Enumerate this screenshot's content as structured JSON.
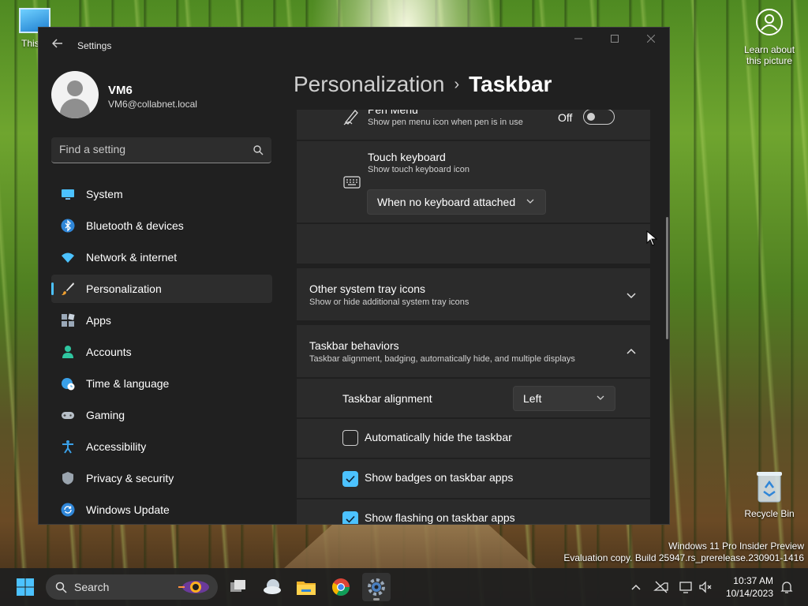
{
  "desktop": {
    "this_pc_label": "This P",
    "learn_label": "Learn about this picture",
    "recycle_label": "Recycle Bin",
    "watermark_line1": "Windows 11 Pro Insider Preview",
    "watermark_line2": "Evaluation copy. Build 25947.rs_prerelease.230901-1416"
  },
  "window": {
    "app_title": "Settings",
    "back_icon": "arrow-left-icon"
  },
  "profile": {
    "name": "VM6",
    "email": "VM6@collabnet.local"
  },
  "search": {
    "placeholder": "Find a setting"
  },
  "nav": {
    "items": [
      {
        "label": "System",
        "icon": "monitor-icon"
      },
      {
        "label": "Bluetooth & devices",
        "icon": "bluetooth-icon"
      },
      {
        "label": "Network & internet",
        "icon": "wifi-icon"
      },
      {
        "label": "Personalization",
        "icon": "brush-icon",
        "active": true
      },
      {
        "label": "Apps",
        "icon": "apps-icon"
      },
      {
        "label": "Accounts",
        "icon": "person-icon"
      },
      {
        "label": "Time & language",
        "icon": "globe-clock-icon"
      },
      {
        "label": "Gaming",
        "icon": "gamepad-icon"
      },
      {
        "label": "Accessibility",
        "icon": "accessibility-icon"
      },
      {
        "label": "Privacy & security",
        "icon": "shield-icon"
      },
      {
        "label": "Windows Update",
        "icon": "update-icon"
      }
    ]
  },
  "breadcrumb": {
    "parent": "Personalization",
    "separator": "›",
    "current": "Taskbar"
  },
  "pen_menu": {
    "title": "Pen Menu",
    "subtitle": "Show pen menu icon when pen is in use",
    "state_label": "Off"
  },
  "touch_keyboard": {
    "title": "Touch keyboard",
    "subtitle": "Show touch keyboard icon",
    "selected": "When no keyboard attached"
  },
  "other_tray": {
    "title": "Other system tray icons",
    "subtitle": "Show or hide additional system tray icons"
  },
  "behaviors": {
    "title": "Taskbar behaviors",
    "subtitle": "Taskbar alignment, badging, automatically hide, and multiple displays",
    "alignment_label": "Taskbar alignment",
    "alignment_value": "Left",
    "options": [
      {
        "label": "Automatically hide the taskbar",
        "checked": false
      },
      {
        "label": "Show badges on taskbar apps",
        "checked": true
      },
      {
        "label": "Show flashing on taskbar apps",
        "checked": true
      }
    ]
  },
  "taskbar": {
    "search_label": "Search",
    "time": "10:37 AM",
    "date": "10/14/2023"
  },
  "colors": {
    "accent": "#4cc2ff",
    "window_bg": "#202020",
    "card_bg": "#2b2b2b"
  }
}
